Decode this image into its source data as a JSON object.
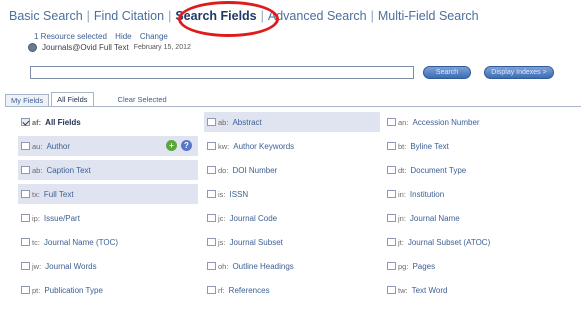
{
  "nav": {
    "tabs": [
      "Basic Search",
      "Find Citation",
      "Search Fields",
      "Advanced Search",
      "Multi-Field Search"
    ],
    "active_tab": "Search Fields",
    "separator": "|"
  },
  "resources": {
    "selected_text": "1 Resource selected",
    "hide_label": "Hide",
    "change_label": "Change",
    "database_name": "Journals@Ovid Full Text",
    "database_date": "February 15, 2012"
  },
  "search": {
    "input_value": "",
    "search_button": "Search",
    "limits_button": "Display Indexes >"
  },
  "field_tabs": {
    "tabs": [
      "My Fields",
      "All Fields"
    ],
    "active": "All Fields",
    "clear_selected": "Clear Selected"
  },
  "fields": [
    [
      {
        "code": "af",
        "label": "All Fields",
        "checked": true,
        "highlight": false,
        "bold": true
      },
      {
        "code": "ab",
        "label": "Abstract",
        "checked": false,
        "highlight": true,
        "bold": false
      },
      {
        "code": "an",
        "label": "Accession Number",
        "checked": false,
        "highlight": false,
        "bold": false
      }
    ],
    [
      {
        "code": "au",
        "label": "Author",
        "checked": false,
        "highlight": true,
        "bold": false,
        "icons": true
      },
      {
        "code": "kw",
        "label": "Author Keywords",
        "checked": false,
        "highlight": false,
        "bold": false
      },
      {
        "code": "bt",
        "label": "Byline Text",
        "checked": false,
        "highlight": false,
        "bold": false
      }
    ],
    [
      {
        "code": "ab",
        "label": "Caption Text",
        "checked": false,
        "highlight": true,
        "bold": false
      },
      {
        "code": "do",
        "label": "DOI Number",
        "checked": false,
        "highlight": false,
        "bold": false
      },
      {
        "code": "dt",
        "label": "Document Type",
        "checked": false,
        "highlight": false,
        "bold": false
      }
    ],
    [
      {
        "code": "tx",
        "label": "Full Text",
        "checked": false,
        "highlight": true,
        "bold": false
      },
      {
        "code": "is",
        "label": "ISSN",
        "checked": false,
        "highlight": false,
        "bold": false
      },
      {
        "code": "in",
        "label": "Institution",
        "checked": false,
        "highlight": false,
        "bold": false
      }
    ],
    [
      {
        "code": "ip",
        "label": "Issue/Part",
        "checked": false,
        "highlight": false,
        "bold": false
      },
      {
        "code": "jc",
        "label": "Journal Code",
        "checked": false,
        "highlight": false,
        "bold": false
      },
      {
        "code": "jn",
        "label": "Journal Name",
        "checked": false,
        "highlight": false,
        "bold": false
      }
    ],
    [
      {
        "code": "tc",
        "label": "Journal Name (TOC)",
        "checked": false,
        "highlight": false,
        "bold": false
      },
      {
        "code": "js",
        "label": "Journal Subset",
        "checked": false,
        "highlight": false,
        "bold": false
      },
      {
        "code": "jt",
        "label": "Journal Subset (ATOC)",
        "checked": false,
        "highlight": false,
        "bold": false
      }
    ],
    [
      {
        "code": "jw",
        "label": "Journal Words",
        "checked": false,
        "highlight": false,
        "bold": false
      },
      {
        "code": "oh",
        "label": "Outline Headings",
        "checked": false,
        "highlight": false,
        "bold": false
      },
      {
        "code": "pg",
        "label": "Pages",
        "checked": false,
        "highlight": false,
        "bold": false
      }
    ],
    [
      {
        "code": "pt",
        "label": "Publication Type",
        "checked": false,
        "highlight": false,
        "bold": false
      },
      {
        "code": "rf",
        "label": "References",
        "checked": false,
        "highlight": false,
        "bold": false
      },
      {
        "code": "tw",
        "label": "Text Word",
        "checked": false,
        "highlight": false,
        "bold": false
      }
    ]
  ],
  "colors": {
    "link": "#4b6fa0",
    "highlight_circle": "#e01b1b",
    "row_highlight": "#dfe4f0",
    "button": "#3e6db4"
  }
}
